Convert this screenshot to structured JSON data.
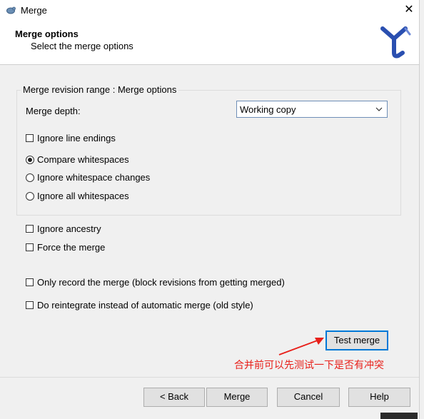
{
  "window": {
    "title": "Merge",
    "icon": "tortoise-icon",
    "close_glyph": "✕"
  },
  "header": {
    "title": "Merge options",
    "subtitle": "Select the merge options",
    "logo": "branch-merge-logo"
  },
  "group": {
    "legend": "Merge revision range : Merge options",
    "merge_depth_label": "Merge depth:",
    "merge_depth_value": "Working copy",
    "ignore_line_endings": {
      "label": "Ignore line endings",
      "checked": false
    },
    "whitespace_options": [
      {
        "label": "Compare whitespaces",
        "selected": true
      },
      {
        "label": "Ignore whitespace changes",
        "selected": false
      },
      {
        "label": "Ignore all whitespaces",
        "selected": false
      }
    ]
  },
  "options": {
    "ignore_ancestry": {
      "label": "Ignore ancestry",
      "checked": false
    },
    "force_merge": {
      "label": "Force the merge",
      "checked": false
    },
    "only_record": {
      "label": "Only record the merge (block revisions from getting merged)",
      "checked": false
    },
    "reintegrate": {
      "label": "Do reintegrate instead of automatic merge (old style)",
      "checked": false
    }
  },
  "test_merge": {
    "label": "Test merge",
    "annotation": "合并前可以先测试一下是否有冲突",
    "annotation_color": "#e8201a"
  },
  "footer": {
    "back": "< Back",
    "merge": "Merge",
    "cancel": "Cancel",
    "help": "Help"
  },
  "colors": {
    "accent": "#0078d7",
    "annotation": "#e8201a",
    "dialog_bg": "#f0f0f0"
  }
}
